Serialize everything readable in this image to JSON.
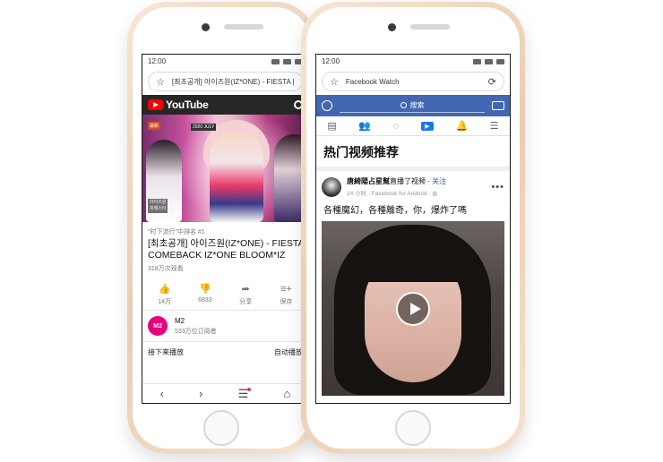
{
  "left_phone": {
    "status_time": "12:00",
    "address": "[최초공개] 아이즈원(IZ*ONE) - FIESTA | COMB",
    "youtube": {
      "brand": "YouTube",
      "video_overlay": {
        "badge": "最新",
        "tag": "2020 JULY",
        "side_caption": "아이즈원\n피에스타"
      },
      "trend_label": "\"时下流行\"中排名 #1",
      "title_line1": "[최초공개] 아이즈원(IZ*ONE) - FIESTA",
      "title_line2": "COMEBACK IZ*ONE BLOOM*IZ",
      "views": "318万次观看",
      "actions": [
        {
          "icon": "like-icon",
          "label": "14万"
        },
        {
          "icon": "dislike-icon",
          "label": "6833"
        },
        {
          "icon": "share-icon",
          "label": "分享"
        },
        {
          "icon": "save-icon",
          "label": "保存"
        }
      ],
      "channel": {
        "avatar_text": "M2",
        "name": "M2",
        "subscribers": "533万位订阅者"
      },
      "up_next": "接下来播放",
      "autoplay": "自动播放"
    }
  },
  "right_phone": {
    "status_time": "12:00",
    "address": "Facebook Watch",
    "facebook": {
      "search_placeholder": "搜索",
      "section_title": "热门视频推荐",
      "post": {
        "author": "唐綺陽占星幫",
        "action": "直播了视频",
        "follow": "关注",
        "meta": "14 小时 · Facebook for Android · ",
        "text": "各種魔幻，各種離奇，你，爆炸了嗎"
      }
    }
  },
  "colors": {
    "youtube_red": "#ff0000",
    "facebook_blue": "#4267b2",
    "phone_gold": "#f1dcc7"
  }
}
